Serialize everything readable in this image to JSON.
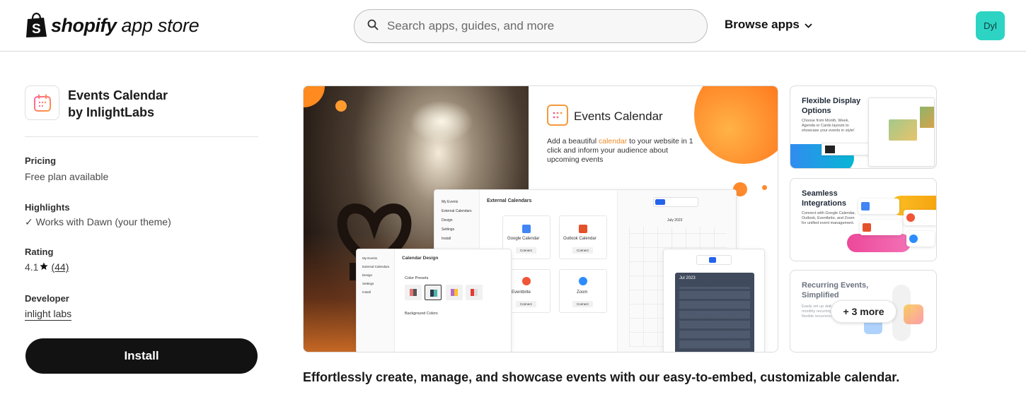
{
  "header": {
    "logo_bold": "shopify",
    "logo_light": "app store",
    "search_placeholder": "Search apps, guides, and more",
    "browse_label": "Browse apps",
    "avatar_initials": "Dyl"
  },
  "app": {
    "name": "Events Calendar",
    "by": "by InlightLabs",
    "pricing_label": "Pricing",
    "pricing_value": "Free plan available",
    "highlights_label": "Highlights",
    "highlights_value": "✓ Works with Dawn (your theme)",
    "rating_label": "Rating",
    "rating_value": "4.1",
    "rating_count": "(44)",
    "developer_label": "Developer",
    "developer_value": "inlight labs",
    "install_label": "Install"
  },
  "hero": {
    "promo_title": "Events Calendar",
    "promo_desc_a": "Add a beautiful ",
    "promo_desc_hl": "calendar",
    "promo_desc_b": " to your website in 1 click and inform your audience about upcoming events",
    "mock_external_title": "External Calendars",
    "mock_design_title": "Calendar Design",
    "mock_presets": "Color Presets",
    "mock_bg": "Background Colors",
    "cal_google": "Google Calendar",
    "cal_outlook": "Outlook Calendar",
    "cal_eventbrite": "Eventbrite",
    "cal_zoom": "Zoom",
    "connect": "Connect",
    "month": "July 2023",
    "month_dark": "Jul 2023",
    "side_items": [
      "My Events",
      "External Calendars",
      "Design",
      "Settings",
      "Install"
    ]
  },
  "thumbs": [
    {
      "title": "Flexible Display Options",
      "desc": "Choose from Month, Week, Agenda or Cards layouts to showcase your events in style!"
    },
    {
      "title": "Seamless Integrations",
      "desc": "Connect with Google Calendar, Outlook, Eventbrite, and Zoom for unified event management."
    },
    {
      "title": "Recurring Events, Simplified",
      "desc": "Easily set up daily, weekly or monthly recurring events with flexible recurrence rules."
    }
  ],
  "more_label": "+ 3 more",
  "tagline": "Effortlessly create, manage, and showcase events with our easy-to-embed, customizable calendar.",
  "colors": {
    "install_bg": "#121212",
    "avatar_bg": "#2dd4c4",
    "accent_orange": "#ff8a2c"
  }
}
